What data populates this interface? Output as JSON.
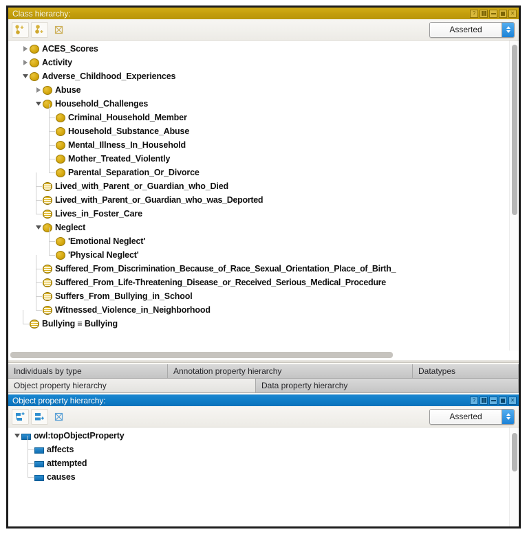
{
  "app": {
    "window_buttons": [
      "help",
      "split",
      "minimize",
      "maximize",
      "close"
    ]
  },
  "class_panel": {
    "title": "Class hierarchy:",
    "accent_color": "#c39d0c",
    "toolbar": {
      "add_subclass_label": "add-subclass",
      "add_sibling_label": "add-sibling-class",
      "delete_label": "delete-class",
      "view_mode": "Asserted"
    },
    "tree": [
      {
        "label": "ACES_Scores",
        "depth": 0,
        "icon": "class",
        "twisty": "collapsed"
      },
      {
        "label": "Activity",
        "depth": 0,
        "icon": "class",
        "twisty": "collapsed"
      },
      {
        "label": "Adverse_Childhood_Experiences",
        "depth": 0,
        "icon": "class",
        "twisty": "expanded"
      },
      {
        "label": "Abuse",
        "depth": 1,
        "icon": "class",
        "twisty": "collapsed"
      },
      {
        "label": "Household_Challenges",
        "depth": 1,
        "icon": "class",
        "twisty": "expanded"
      },
      {
        "label": "Criminal_Household_Member",
        "depth": 2,
        "icon": "class",
        "twisty": "leaf"
      },
      {
        "label": "Household_Substance_Abuse",
        "depth": 2,
        "icon": "class",
        "twisty": "leaf"
      },
      {
        "label": "Mental_Illness_In_Household",
        "depth": 2,
        "icon": "class",
        "twisty": "leaf"
      },
      {
        "label": "Mother_Treated_Violently",
        "depth": 2,
        "icon": "class",
        "twisty": "leaf"
      },
      {
        "label": "Parental_Separation_Or_Divorce",
        "depth": 2,
        "icon": "class",
        "twisty": "leaf"
      },
      {
        "label": "Lived_with_Parent_or_Guardian_who_Died",
        "depth": 1,
        "icon": "defined",
        "twisty": "leaf"
      },
      {
        "label": "Lived_with_Parent_or_Guardian_who_was_Deported",
        "depth": 1,
        "icon": "defined",
        "twisty": "leaf"
      },
      {
        "label": "Lives_in_Foster_Care",
        "depth": 1,
        "icon": "defined",
        "twisty": "leaf"
      },
      {
        "label": "Neglect",
        "depth": 1,
        "icon": "class",
        "twisty": "expanded"
      },
      {
        "label": "'Emotional Neglect'",
        "depth": 2,
        "icon": "class",
        "twisty": "leaf"
      },
      {
        "label": "'Physical Neglect'",
        "depth": 2,
        "icon": "class",
        "twisty": "leaf"
      },
      {
        "label": "Suffered_From_Discrimination_Because_of_Race_Sexual_Orientation_Place_of_Birth_",
        "depth": 1,
        "icon": "defined",
        "twisty": "leaf"
      },
      {
        "label": "Suffered_From_Life-Threatening_Disease_or_Received_Serious_Medical_Procedure",
        "depth": 1,
        "icon": "defined",
        "twisty": "leaf"
      },
      {
        "label": "Suffers_From_Bullying_in_School",
        "depth": 1,
        "icon": "defined",
        "twisty": "leaf"
      },
      {
        "label": "Witnessed_Violence_in_Neighborhood",
        "depth": 1,
        "icon": "defined",
        "twisty": "leaf"
      },
      {
        "label": "Bullying ≡ Bullying",
        "depth": 0,
        "icon": "defined",
        "twisty": "leaf"
      }
    ]
  },
  "tabs": {
    "row1": [
      {
        "label": "Individuals by type",
        "active": false
      },
      {
        "label": "Annotation property hierarchy",
        "active": false
      },
      {
        "label": "Datatypes",
        "active": false
      }
    ],
    "row2": [
      {
        "label": "Object property hierarchy",
        "active": true
      },
      {
        "label": "Data property hierarchy",
        "active": false
      }
    ]
  },
  "property_panel": {
    "title": "Object property hierarchy:",
    "accent_color": "#0f7cc6",
    "toolbar": {
      "add_subproperty_label": "add-sub-property",
      "add_sibling_label": "add-sibling-property",
      "delete_label": "delete-property",
      "view_mode": "Asserted"
    },
    "tree": [
      {
        "label": "owl:topObjectProperty",
        "depth": 0,
        "icon": "property",
        "twisty": "expanded"
      },
      {
        "label": "affects",
        "depth": 1,
        "icon": "property",
        "twisty": "leaf"
      },
      {
        "label": "attempted",
        "depth": 1,
        "icon": "property",
        "twisty": "leaf"
      },
      {
        "label": "causes",
        "depth": 1,
        "icon": "property",
        "twisty": "leaf"
      }
    ]
  }
}
